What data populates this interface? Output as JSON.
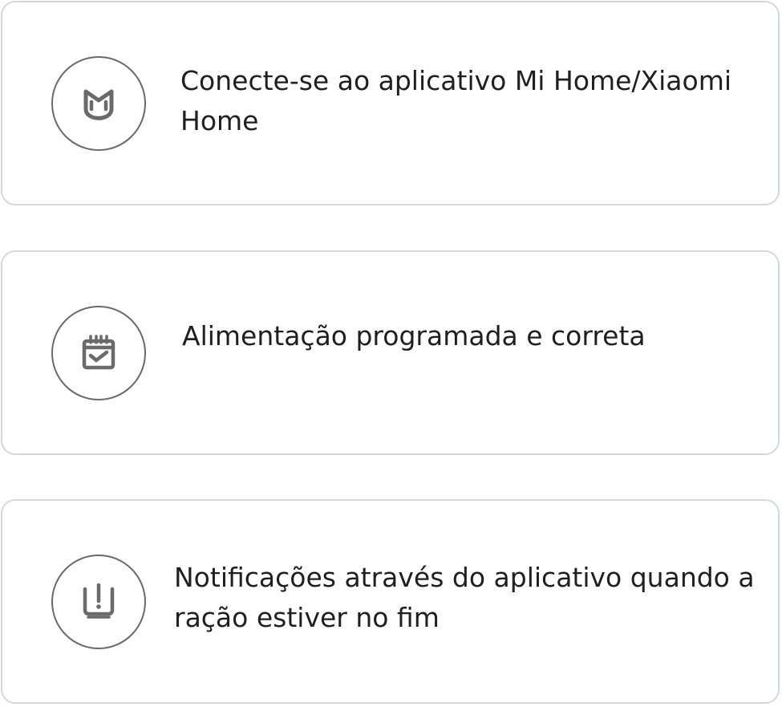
{
  "features": [
    {
      "icon": "mi-home-icon",
      "text": "Conecte-se ao aplicativo Mi Home/Xiaomi Home"
    },
    {
      "icon": "calendar-check-icon",
      "text": "Alimentação programada e correta"
    },
    {
      "icon": "bowl-alert-icon",
      "text": "Notificações através do aplicativo quando a ração estiver no fim"
    }
  ],
  "colors": {
    "border": "#d3d9d8",
    "icon": "#6a6a6a",
    "text": "#1f1f1f"
  }
}
